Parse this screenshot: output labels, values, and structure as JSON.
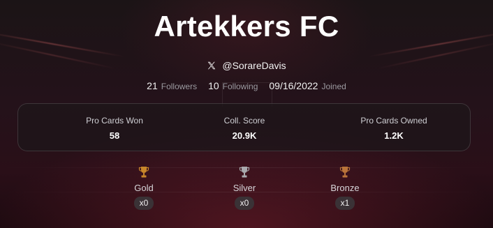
{
  "profile": {
    "club_name": "Artekkers FC",
    "handle_icon": "x-logo-icon",
    "handle": "@SorareDavis"
  },
  "stats": {
    "followers_count": "21",
    "followers_label": "Followers",
    "following_count": "10",
    "following_label": "Following",
    "joined_date": "09/16/2022",
    "joined_label": "Joined"
  },
  "summary_card": {
    "items": [
      {
        "label": "Pro Cards Won",
        "value": "58"
      },
      {
        "label": "Coll. Score",
        "value": "20.9K"
      },
      {
        "label": "Pro Cards Owned",
        "value": "1.2K"
      }
    ]
  },
  "trophies": [
    {
      "icon": "trophy-gold-icon",
      "label": "Gold",
      "count": "x0",
      "color": "#c8862a"
    },
    {
      "icon": "trophy-silver-icon",
      "label": "Silver",
      "count": "x0",
      "color": "#a9a9ad"
    },
    {
      "icon": "trophy-bronze-icon",
      "label": "Bronze",
      "count": "x1",
      "color": "#b9743a"
    }
  ]
}
